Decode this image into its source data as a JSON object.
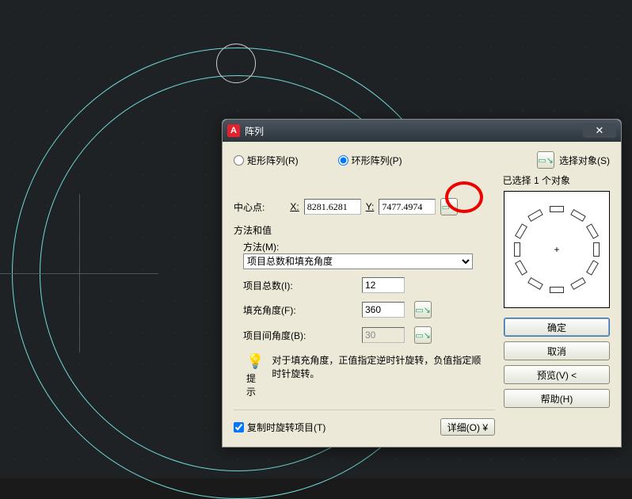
{
  "dialog": {
    "title": "阵列",
    "app_initial": "A",
    "rect_array_label": "矩形阵列(R)",
    "polar_array_label": "环形阵列(P)",
    "select_objects_label": "选择对象(S)",
    "selected_status": "已选择 1 个对象",
    "center_point_label": "中心点:",
    "x_label": "X:",
    "x_value": "8281.6281",
    "y_label": "Y:",
    "y_value": "7477.4974",
    "method_value_title": "方法和值",
    "method_label": "方法(M):",
    "method_selected": "项目总数和填充角度",
    "total_items_label": "项目总数(I):",
    "total_items_value": "12",
    "fill_angle_label": "填充角度(F):",
    "fill_angle_value": "360",
    "item_angle_label": "项目间角度(B):",
    "item_angle_value": "30",
    "hint_text": "对于填充角度，正值指定逆时针旋转，负值指定顺时针旋转。",
    "hint_label": "提示",
    "rotate_copy_label": "复制时旋转项目(T)",
    "details_label": "详细(O)",
    "ok_label": "确定",
    "cancel_label": "取消",
    "preview_label": "预览(V) <",
    "help_label": "帮助(H)"
  }
}
